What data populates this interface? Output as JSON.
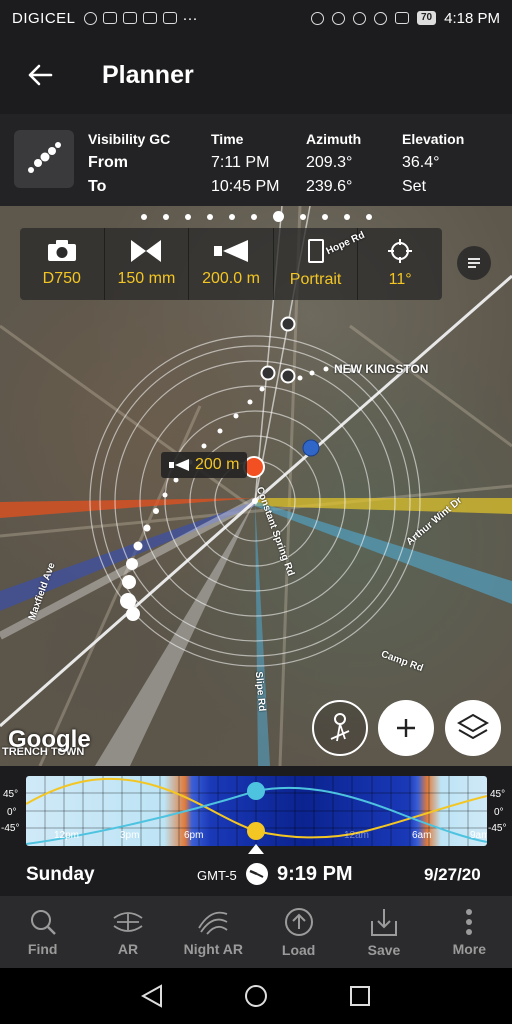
{
  "status_bar": {
    "carrier": "DIGICEL",
    "battery": "70",
    "time": "4:18 PM",
    "overflow": "···"
  },
  "header": {
    "title": "Planner",
    "back_icon": "arrow-left-icon"
  },
  "info": {
    "row_from": "From",
    "row_to": "To",
    "visibility_label": "Visibility GC",
    "time_label": "Time",
    "time_from": "7:11 PM",
    "time_to": "10:45 PM",
    "azimuth_label": "Azimuth",
    "azimuth_from": "209.3°",
    "azimuth_to": "239.6°",
    "elevation_label": "Elevation",
    "elevation_from": "36.4°",
    "elevation_to": "Set"
  },
  "settings": {
    "camera": "D750",
    "focal": "150 mm",
    "distance": "200.0 m",
    "orientation": "Portrait",
    "tilt": "11°"
  },
  "map": {
    "distance_tag": "200 m",
    "labels": [
      "NEW KINGSTON",
      "Maxfield Ave",
      "Constant Spring Rd",
      "Slipe Rd",
      "Camp Rd",
      "Arthur Wint Dr",
      "Hope Rd",
      "TRENCH TOWN"
    ],
    "attribution": "Google",
    "page_dots": 11,
    "active_dot": 6
  },
  "timeline": {
    "y_ticks": [
      "45°",
      "0°",
      "-45°"
    ],
    "x_ticks": [
      "12pm",
      "3pm",
      "6pm",
      "12am",
      "6am",
      "9am"
    ]
  },
  "date_row": {
    "day": "Sunday",
    "timezone": "GMT-5",
    "time": "9:19 PM",
    "date": "9/27/20"
  },
  "nav": [
    {
      "label": "Find",
      "icon": "search-icon"
    },
    {
      "label": "AR",
      "icon": "ar-icon"
    },
    {
      "label": "Night AR",
      "icon": "night-ar-icon"
    },
    {
      "label": "Load",
      "icon": "upload-icon"
    },
    {
      "label": "Save",
      "icon": "save-icon"
    },
    {
      "label": "More",
      "icon": "more-vertical-icon"
    }
  ],
  "colors": {
    "accent_yellow": "#f3c623",
    "sun_marker": "#f25022",
    "moon_line": "#4ec3e0"
  }
}
